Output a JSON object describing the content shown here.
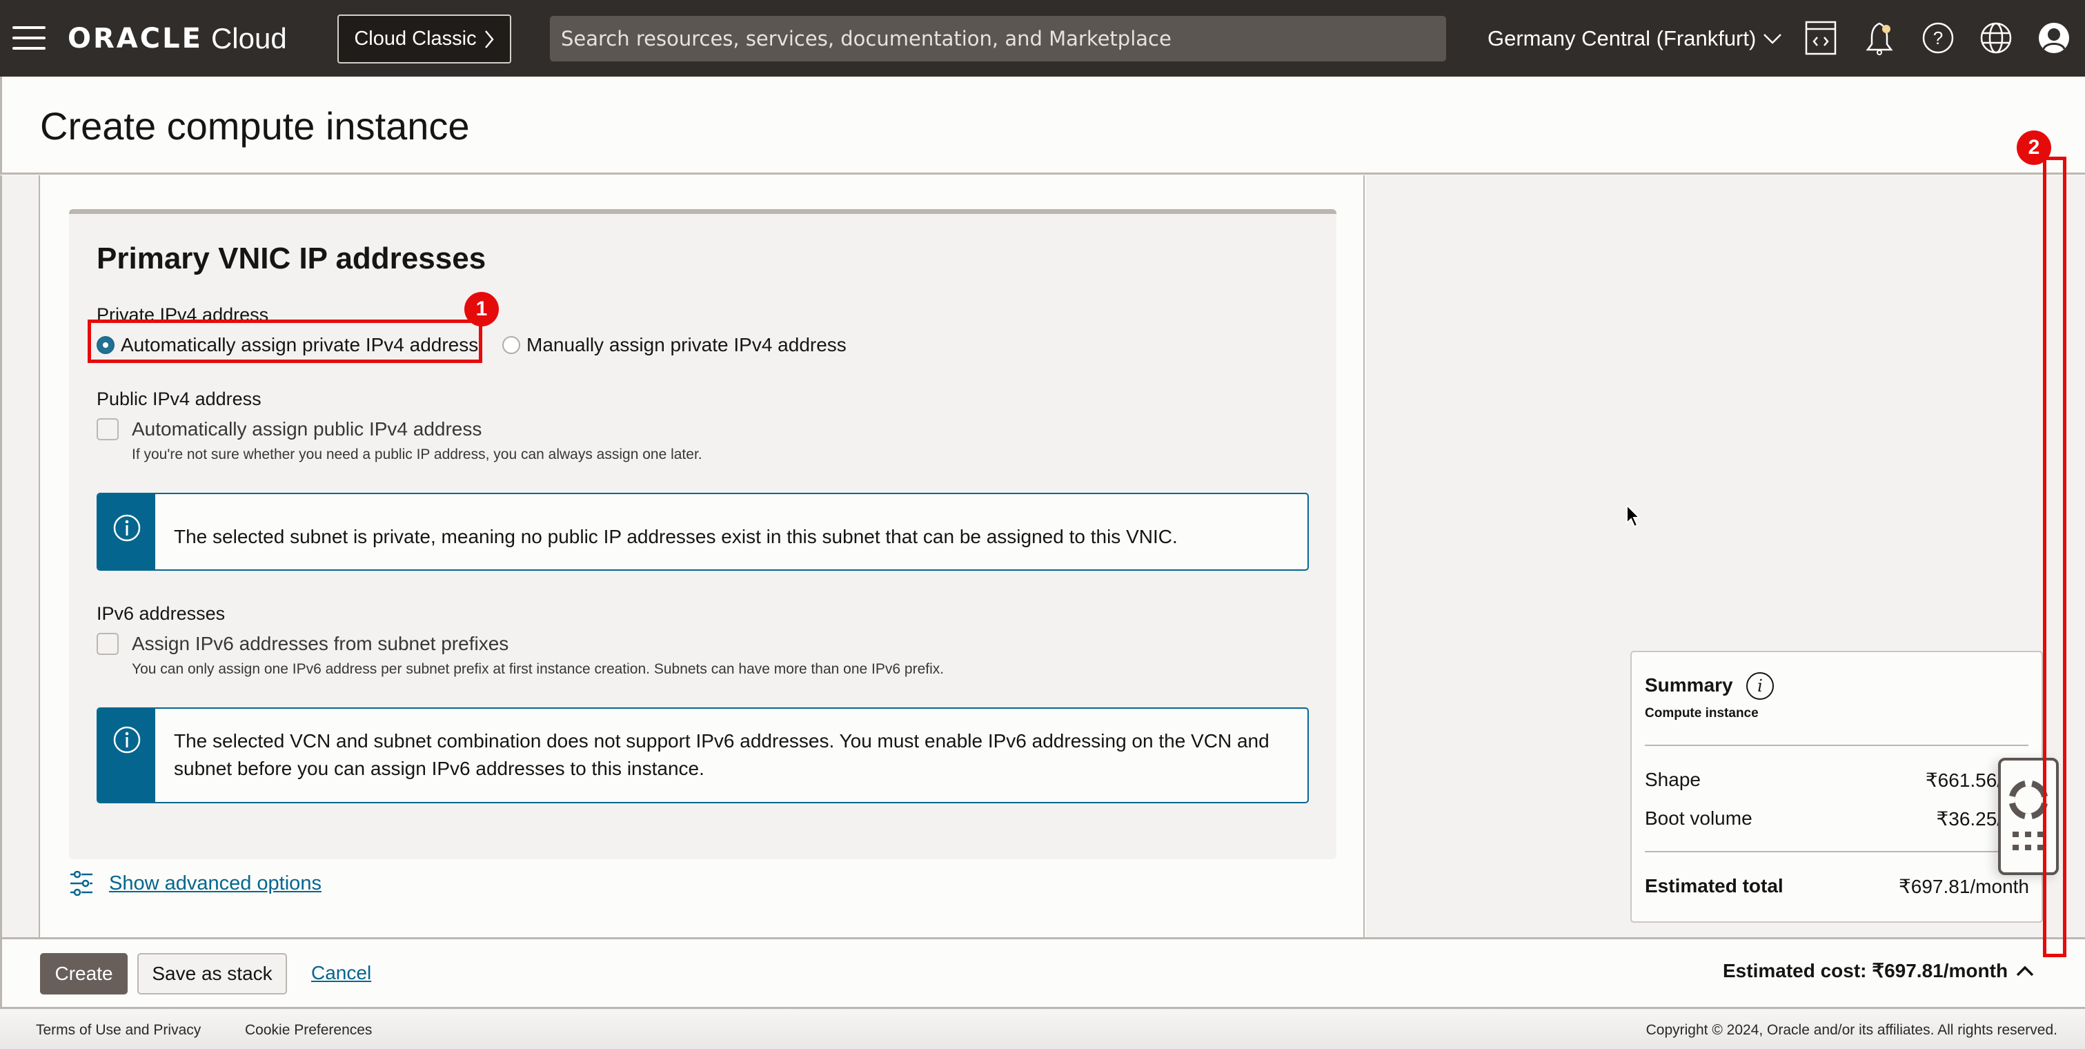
{
  "header": {
    "brand_oracle": "ORACLE",
    "brand_cloud": "Cloud",
    "classic_button": "Cloud Classic",
    "search_placeholder": "Search resources, services, documentation, and Marketplace",
    "region": "Germany Central (Frankfurt)",
    "icons": [
      "menu-icon",
      "code-editor-icon",
      "notifications-bell-icon",
      "help-icon",
      "language-globe-icon",
      "profile-avatar-icon"
    ]
  },
  "page": {
    "title": "Create compute instance"
  },
  "section": {
    "title": "Primary VNIC IP addresses",
    "private_ipv4": {
      "label": "Private IPv4 address",
      "options": [
        {
          "label": "Automatically assign private IPv4 address",
          "selected": true
        },
        {
          "label": "Manually assign private IPv4 address",
          "selected": false
        }
      ]
    },
    "public_ipv4": {
      "label": "Public IPv4 address",
      "checkbox_label": "Automatically assign public IPv4 address",
      "checked": false,
      "help": "If you're not sure whether you need a public IP address, you can always assign one later.",
      "info": "The selected subnet is private, meaning no public IP addresses exist in this subnet that can be assigned to this VNIC."
    },
    "ipv6": {
      "label": "IPv6 addresses",
      "checkbox_label": "Assign IPv6 addresses from subnet prefixes",
      "checked": false,
      "help": "You can only assign one IPv6 address per subnet prefix at first instance creation. Subnets can have more than one IPv6 prefix.",
      "info_line1": "The selected VCN and subnet combination does not support IPv6 addresses. You must enable IPv6 addressing on the VCN and",
      "info_line2": "subnet before you can assign IPv6 addresses to this instance."
    },
    "advanced_link": "Show advanced options"
  },
  "summary": {
    "title": "Summary",
    "subtitle": "Compute instance",
    "rows": [
      {
        "label": "Shape",
        "value": "₹661.56/mo"
      },
      {
        "label": "Boot volume",
        "value": "₹36.25/mo"
      }
    ],
    "total_label": "Estimated total",
    "total_value": "₹697.81/month"
  },
  "actions": {
    "create": "Create",
    "save_stack": "Save as stack",
    "cancel": "Cancel",
    "estimated_cost": "Estimated cost: ₹697.81/month"
  },
  "footer": {
    "terms": "Terms of Use and Privacy",
    "cookies": "Cookie Preferences",
    "copyright": "Copyright © 2024, Oracle and/or its affiliates. All rights reserved."
  },
  "annotations": [
    {
      "number": "1",
      "target": "Automatically assign private IPv4 address"
    },
    {
      "number": "2",
      "target": "page scrollbar"
    }
  ],
  "colors": {
    "header_bg": "#312d2a",
    "accent_teal": "#04668f",
    "annotation_red": "#e60b0b",
    "primary_button": "#695f5a"
  }
}
